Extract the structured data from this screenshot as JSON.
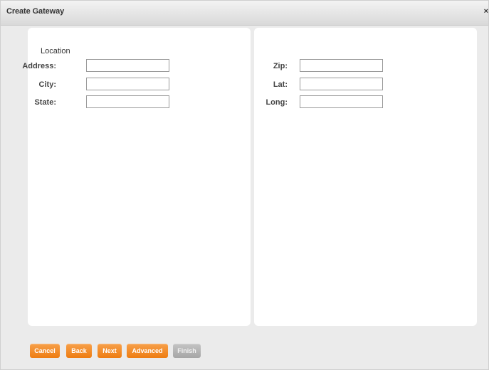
{
  "dialog": {
    "title": "Create Gateway",
    "close_label": "×"
  },
  "form": {
    "section_label": "Location",
    "left_fields": [
      {
        "label": "Address:",
        "value": ""
      },
      {
        "label": "City:",
        "value": ""
      },
      {
        "label": "State:",
        "value": ""
      }
    ],
    "right_fields": [
      {
        "label": "Zip:",
        "value": ""
      },
      {
        "label": "Lat:",
        "value": ""
      },
      {
        "label": "Long:",
        "value": ""
      }
    ]
  },
  "buttons": {
    "cancel": "Cancel",
    "back": "Back",
    "next": "Next",
    "advanced": "Advanced",
    "finish": "Finish"
  },
  "colors": {
    "primary_button": "#ee7d12",
    "disabled_button": "#a6a6a6"
  }
}
